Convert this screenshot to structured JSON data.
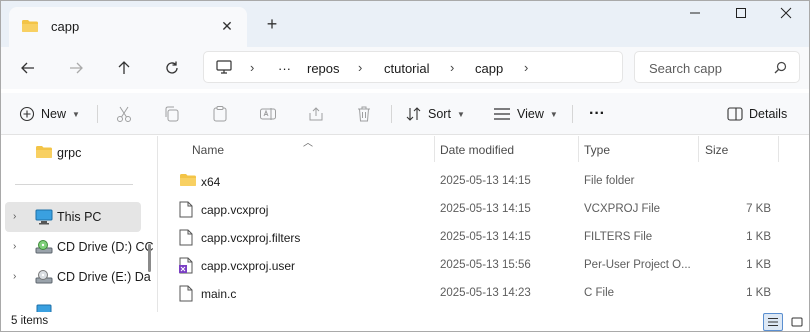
{
  "tab": {
    "title": "capp",
    "close": "✕",
    "new": "+"
  },
  "window_controls": {
    "minimize": "─",
    "maximize": "☐",
    "close": "✕"
  },
  "address": {
    "more": "···",
    "crumbs": [
      "repos",
      "ctutorial",
      "capp"
    ],
    "sep": "›"
  },
  "search": {
    "placeholder": "Search capp"
  },
  "commands": {
    "new": "New",
    "sort": "Sort",
    "view": "View",
    "more": "···",
    "details": "Details"
  },
  "sidebar": {
    "items": [
      {
        "label": "grpc",
        "icon": "folder-icon",
        "expander": ""
      },
      {
        "label": "This PC",
        "icon": "pc-icon",
        "expander": "›"
      },
      {
        "label": "CD Drive (D:) CC",
        "icon": "cd-drive-icon",
        "expander": "›"
      },
      {
        "label": "CD Drive (E:) Da",
        "icon": "cd-drive-icon",
        "expander": "›"
      }
    ]
  },
  "columns": {
    "name": "Name",
    "date": "Date modified",
    "type": "Type",
    "size": "Size"
  },
  "files": [
    {
      "name": "x64",
      "date": "2025-05-13 14:15",
      "type": "File folder",
      "size": "",
      "icon": "folder-icon"
    },
    {
      "name": "capp.vcxproj",
      "date": "2025-05-13 14:15",
      "type": "VCXPROJ File",
      "size": "7 KB",
      "icon": "file-icon"
    },
    {
      "name": "capp.vcxproj.filters",
      "date": "2025-05-13 14:15",
      "type": "FILTERS File",
      "size": "1 KB",
      "icon": "file-icon"
    },
    {
      "name": "capp.vcxproj.user",
      "date": "2025-05-13 15:56",
      "type": "Per-User Project O...",
      "size": "1 KB",
      "icon": "vs-project-icon"
    },
    {
      "name": "main.c",
      "date": "2025-05-13 14:23",
      "type": "C File",
      "size": "1 KB",
      "icon": "file-icon"
    }
  ],
  "status": {
    "items": "5 items"
  },
  "colors": {
    "accent": "#0067c0",
    "folder": "#f3c447",
    "selected": "#e5e5e5"
  }
}
